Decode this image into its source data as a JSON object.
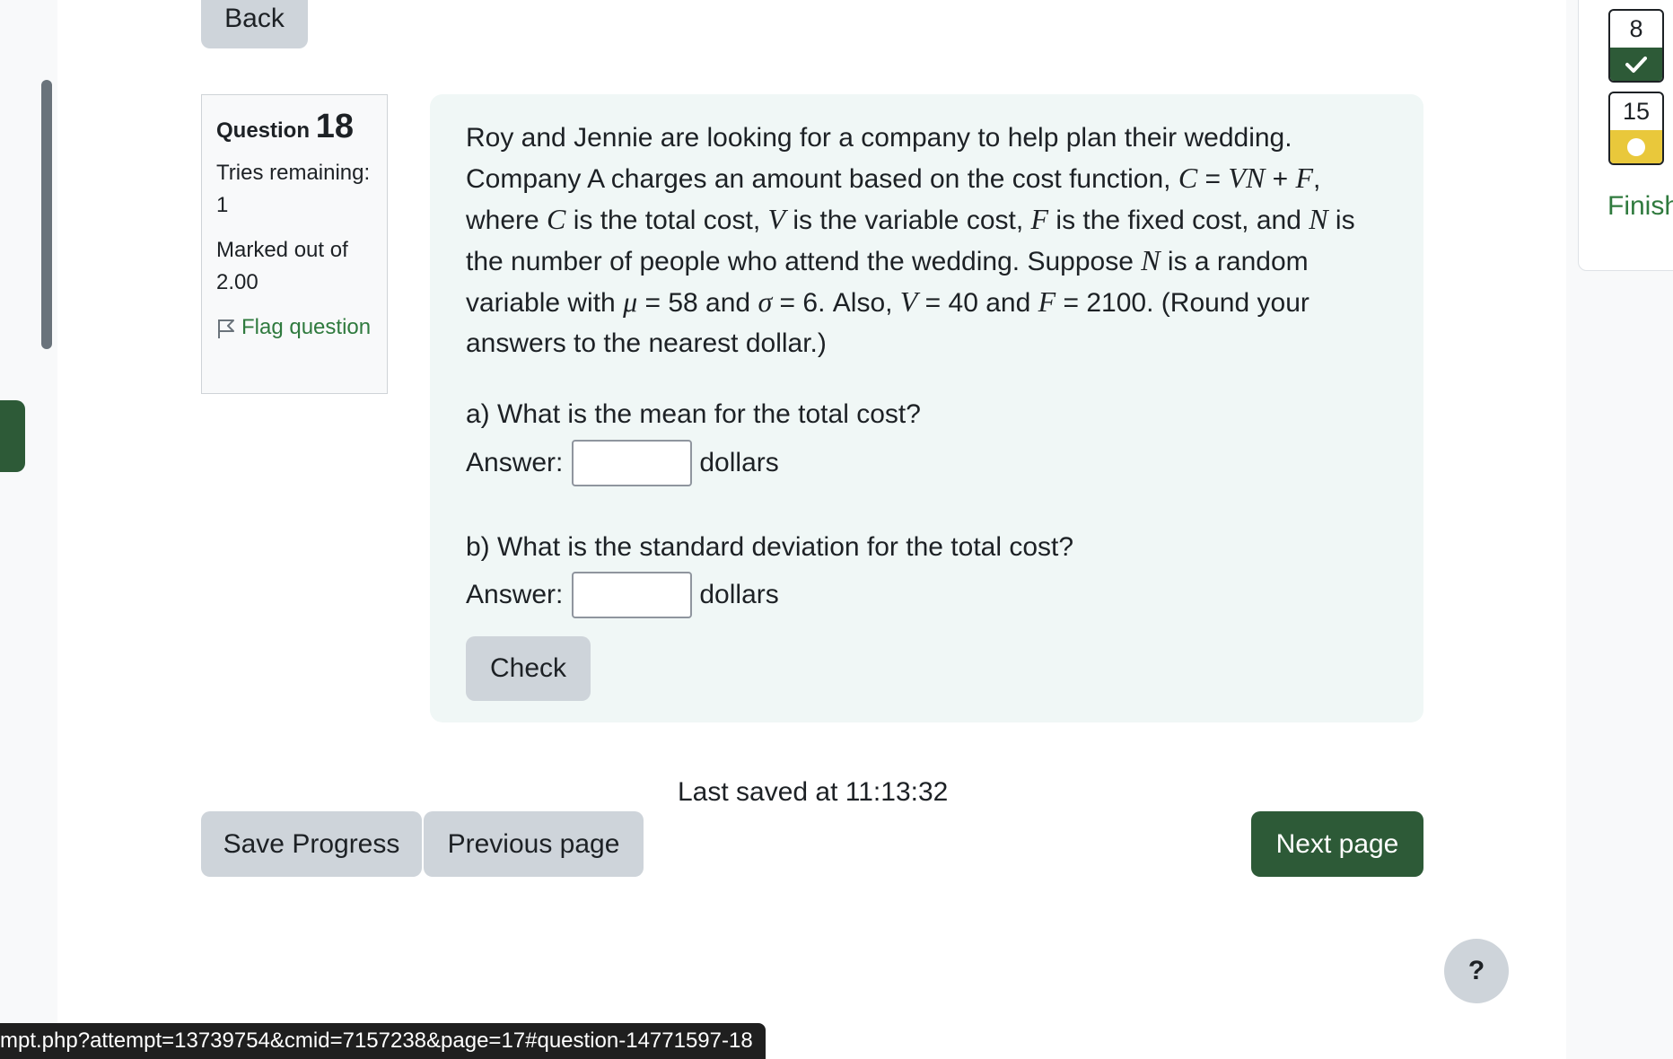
{
  "top": {
    "back_label": "Back"
  },
  "question_info": {
    "label": "Question",
    "number": "18",
    "tries": "Tries remaining: 1",
    "marked": "Marked out of 2.00",
    "flag_label": "Flag question"
  },
  "question": {
    "text_parts": {
      "p1": "Roy and Jennie are looking for a company to help plan their wedding. Company A charges an amount based on the cost function, ",
      "eq_C": "C",
      "eq_mid": " = ",
      "eq_VN": "VN",
      "eq_plus": " + ",
      "eq_F": "F",
      "p2": ", where ",
      "v_C": "C",
      "p3": " is the total cost, ",
      "v_V": "V",
      "p4": " is the variable cost, ",
      "v_F": "F",
      "p5": " is the fixed cost, and ",
      "v_N": "N",
      "p6": " is the number of people who attend the wedding. Suppose ",
      "v_N2": "N",
      "p7": " is a random variable with ",
      "mu": "μ",
      "p8": " = 58 and ",
      "sigma": "σ",
      "p9": " = 6. Also, ",
      "v_V2": "V",
      "p10": " = 40 and ",
      "v_F2": "F",
      "p11": " = 2100. (Round your answers to the nearest dollar.)"
    },
    "part_a": "a) What is the mean for the total cost?",
    "part_b": "b) What is the standard deviation for the total cost?",
    "answer_label": "Answer:",
    "unit": "dollars",
    "answer_a_value": "",
    "answer_b_value": "",
    "check_label": "Check"
  },
  "footer": {
    "last_saved": "Last saved at 11:13:32",
    "save_progress": "Save Progress",
    "previous_page": "Previous page",
    "next_page": "Next page"
  },
  "quiz_nav": {
    "items": [
      {
        "number": "8",
        "state": "correct"
      },
      {
        "number": "15",
        "state": "partial"
      }
    ],
    "finish_label": "Finish"
  },
  "help": {
    "label": "?"
  },
  "status_bar": {
    "url": "mpt.php?attempt=13739754&cmid=7157238&page=17#question-14771597-18"
  }
}
